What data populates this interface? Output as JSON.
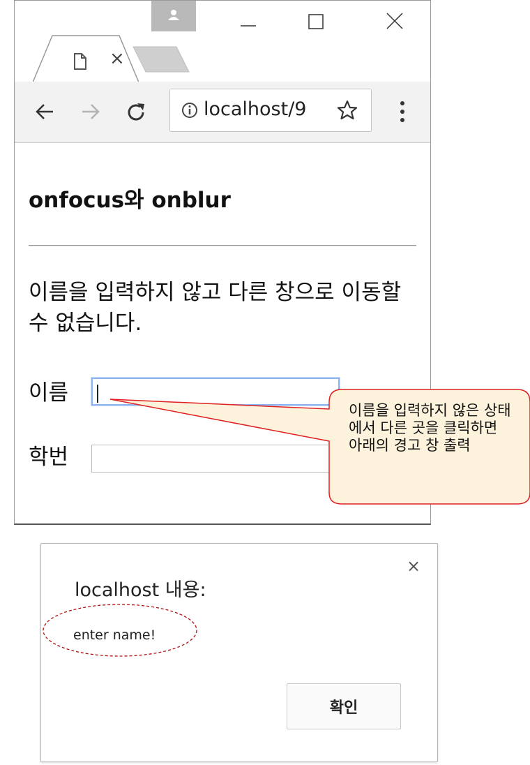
{
  "browser": {
    "tab_close_glyph": "×",
    "address_url": "localhost/9",
    "window_controls": [
      "minimize-icon",
      "maximize-icon",
      "close-icon"
    ],
    "toolbar_icons": [
      "back-arrow-icon",
      "forward-arrow-icon",
      "reload-icon",
      "info-icon",
      "star-icon",
      "menu-dots-icon"
    ],
    "profile_icon": "person-icon"
  },
  "page": {
    "title": "onfocus와 onblur",
    "description": "이름을 입력하지 않고 다른 창으로 이동할 수 없습니다.",
    "fields": [
      {
        "label": "이름",
        "value": "",
        "focused": true
      },
      {
        "label": "학번",
        "value": "",
        "focused": false
      }
    ]
  },
  "callout": {
    "text": "이름을 입력하지 않은 상태에서 다른 곳을 클릭하면 아래의 경고 창 출력",
    "fill": "#fdf3dc",
    "stroke": "#e02020"
  },
  "alert_dialog": {
    "title": "localhost 내용:",
    "close_glyph": "×",
    "message": "enter name!",
    "ok_label": "확인",
    "highlight_stroke": "#b01010"
  }
}
